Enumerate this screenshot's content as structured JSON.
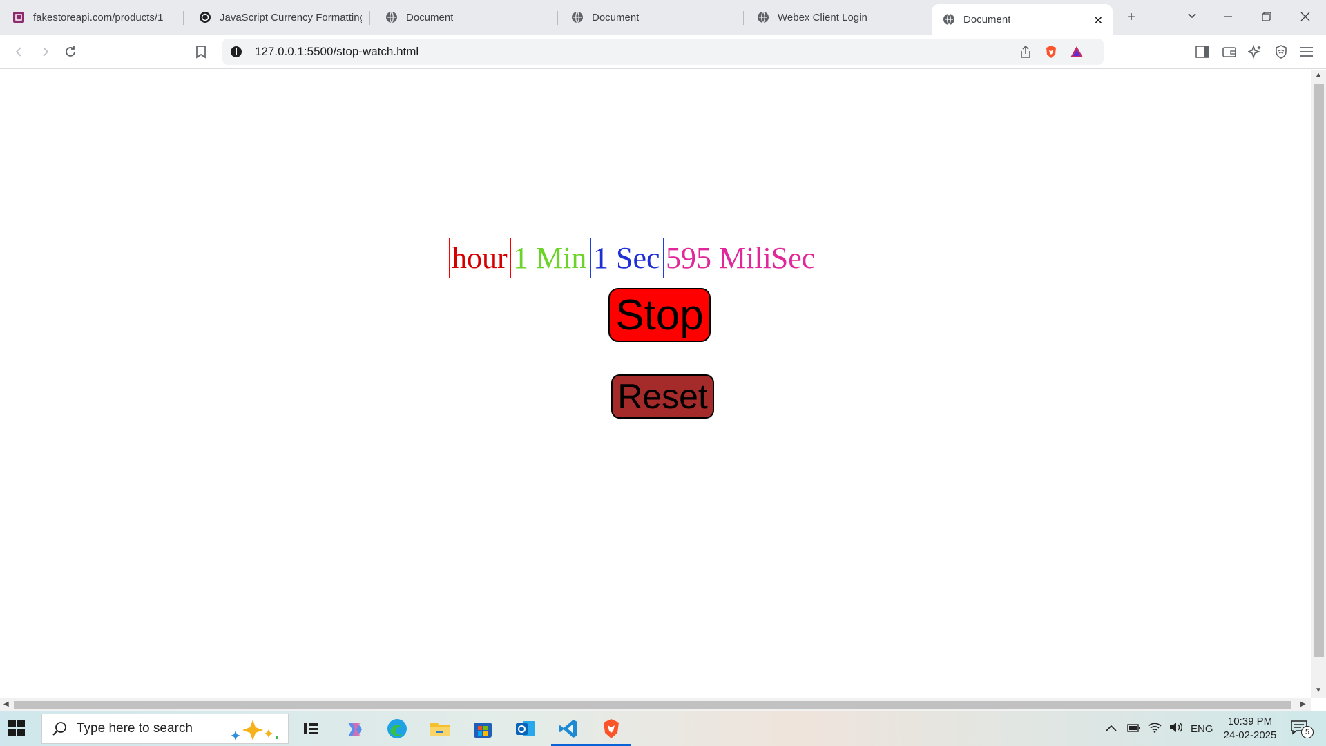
{
  "tabs": [
    {
      "label": "fakestoreapi.com/products/1",
      "icon": "fakestore-favicon"
    },
    {
      "label": "JavaScript Currency Formatting",
      "icon": "openai-favicon"
    },
    {
      "label": "Document",
      "icon": "globe-icon"
    },
    {
      "label": "Document",
      "icon": "globe-icon"
    },
    {
      "label": "Webex Client Login",
      "icon": "globe-icon"
    },
    {
      "label": "Document",
      "icon": "globe-icon",
      "active": true
    }
  ],
  "address": {
    "url": "127.0.0.1:5500/stop-watch.html"
  },
  "stopwatch": {
    "hour": "hour",
    "min": "1 Min",
    "sec": "1 Sec",
    "ms": "595 MiliSec",
    "stop_label": "Stop",
    "reset_label": "Reset"
  },
  "taskbar": {
    "search_placeholder": "Type here to search",
    "lang": "ENG",
    "time": "10:39 PM",
    "date": "24-02-2025",
    "notification_count": "5"
  },
  "colors": {
    "stop_button": "#ff0000",
    "reset_button": "#a52a2a",
    "hour": "#d40000",
    "min": "#6cd428",
    "sec": "#1f2fd6",
    "ms": "#e0289a"
  }
}
